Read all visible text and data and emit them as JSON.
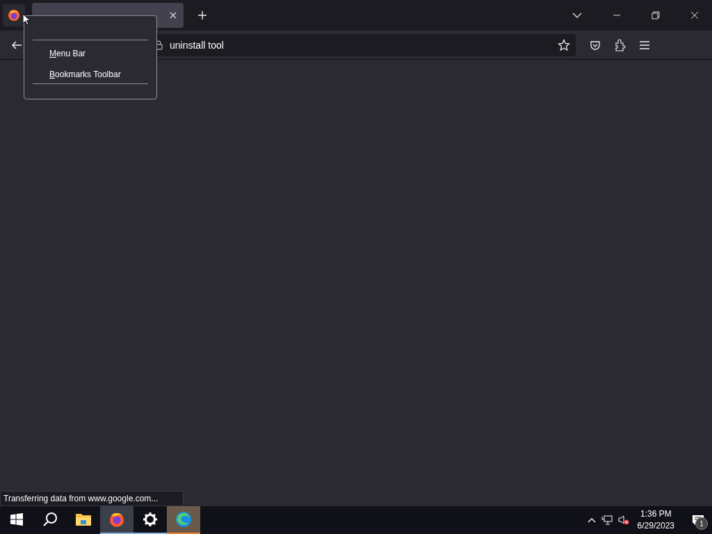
{
  "tabs": [
    {
      "selected": true
    }
  ],
  "url_bar": {
    "value": "uninstall tool"
  },
  "context_menu": {
    "items": [
      {
        "label": "Menu Bar"
      },
      {
        "label": "Bookmarks Toolbar"
      }
    ]
  },
  "status_text": "Transferring data from www.google.com...",
  "taskbar": {
    "apps": [
      {
        "kind": "start",
        "active": false,
        "open": false,
        "attention": false
      },
      {
        "kind": "search",
        "active": false,
        "open": false,
        "attention": false
      },
      {
        "kind": "folder",
        "active": false,
        "open": false,
        "attention": false
      },
      {
        "kind": "browser-fox",
        "active": true,
        "open": true,
        "attention": false
      },
      {
        "kind": "gear",
        "active": false,
        "open": true,
        "attention": false
      },
      {
        "kind": "browser-wave",
        "active": false,
        "open": false,
        "attention": true
      }
    ],
    "time": "1:36 PM",
    "date": "6/29/2023",
    "notification_count": "1"
  }
}
